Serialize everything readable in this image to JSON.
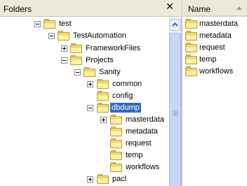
{
  "folders_pane": {
    "title": "Folders",
    "close_glyph": "✕"
  },
  "tree": [
    {
      "label": "test",
      "expander": "minus",
      "selected": false
    },
    {
      "label": "TestAutomation",
      "expander": "minus",
      "selected": false
    },
    {
      "label": "FrameworkFiles",
      "expander": "plus",
      "selected": false
    },
    {
      "label": "Projects",
      "expander": "minus",
      "selected": false
    },
    {
      "label": "Sanity",
      "expander": "minus",
      "selected": false
    },
    {
      "label": "common",
      "expander": "plus",
      "selected": false
    },
    {
      "label": "config",
      "expander": "none",
      "selected": false
    },
    {
      "label": "dbdump",
      "expander": "minus",
      "selected": true
    },
    {
      "label": "masterdata",
      "expander": "plus",
      "selected": false
    },
    {
      "label": "metadata",
      "expander": "none",
      "selected": false
    },
    {
      "label": "request",
      "expander": "none",
      "selected": false
    },
    {
      "label": "temp",
      "expander": "none",
      "selected": false
    },
    {
      "label": "workflows",
      "expander": "none",
      "selected": false
    },
    {
      "label": "pacl",
      "expander": "plus",
      "selected": false
    }
  ],
  "name_pane": {
    "column_header": "Name",
    "sort": "ascending",
    "items": [
      "masterdata",
      "metadata",
      "request",
      "temp",
      "workflows"
    ]
  },
  "icons": {
    "folder": "folder-icon",
    "expand": "plus-expander-icon",
    "collapse": "minus-expander-icon",
    "close": "close-icon",
    "scroll_up": "scroll-up-arrow-icon",
    "sort": "sort-ascending-icon"
  },
  "colors": {
    "selection": "#316ac5",
    "folder": "#f9e27a",
    "header": "#ece9d8"
  }
}
